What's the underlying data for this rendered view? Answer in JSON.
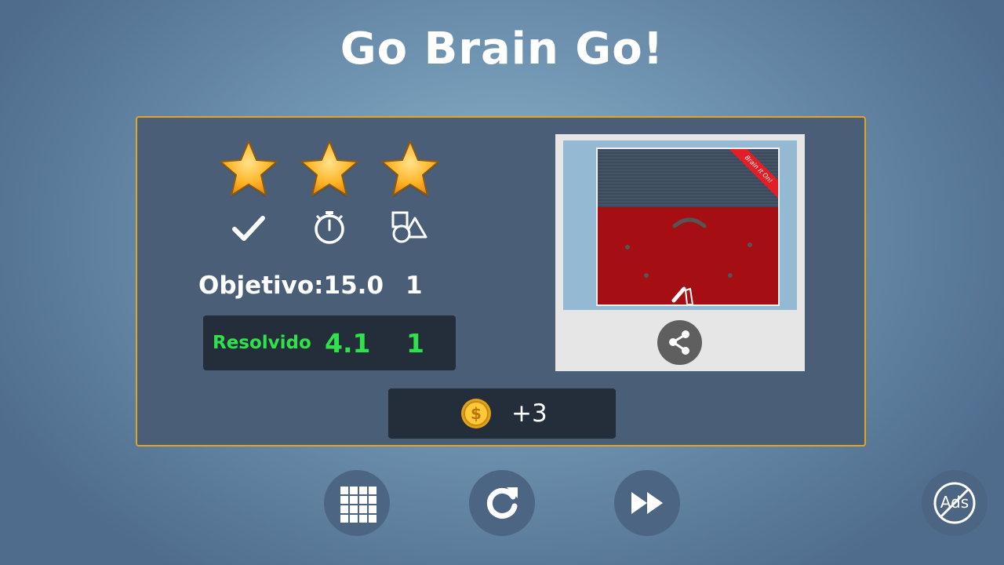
{
  "title": "Go Brain Go!",
  "stars": [
    {
      "name": "completion-star",
      "earned": true
    },
    {
      "name": "time-star",
      "earned": true
    },
    {
      "name": "shapes-star",
      "earned": true
    }
  ],
  "criteria_icons": [
    "checkmark-icon",
    "stopwatch-icon",
    "shapes-icon"
  ],
  "objective": {
    "label": "Objetivo:15.0",
    "count": "1"
  },
  "result": {
    "label": "Resolvido",
    "time": "4.1",
    "count": "1"
  },
  "screenshot": {
    "ribbon_text": "Brain It On!",
    "share_icon": "share-icon"
  },
  "reward": {
    "icon": "coin-icon",
    "amount": "+3"
  },
  "buttons": [
    {
      "name": "level-menu-button",
      "icon": "grid-icon"
    },
    {
      "name": "restart-button",
      "icon": "restart-icon"
    },
    {
      "name": "next-level-button",
      "icon": "fast-forward-icon"
    },
    {
      "name": "remove-ads-button",
      "icon": "no-ads-icon",
      "label": "Ads"
    }
  ],
  "colors": {
    "panel_border": "#e0a526",
    "result_text": "#2fe14b",
    "panel_bg": "#4a5e78"
  }
}
